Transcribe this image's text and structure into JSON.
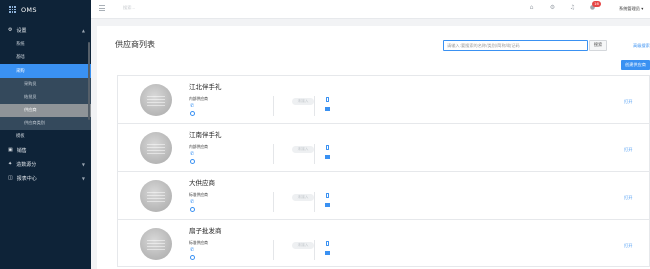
{
  "app": {
    "name": "OMS"
  },
  "sidebar": {
    "groups": [
      {
        "label": "设置",
        "icon": "gear-icon"
      },
      {
        "label": "销售",
        "icon": "shop-icon"
      },
      {
        "label": "造数源分",
        "icon": "star-icon"
      },
      {
        "label": "报表中心",
        "icon": "chart-icon"
      }
    ],
    "items": [
      "系统",
      "基础",
      "采购",
      "采购员",
      "结批员",
      "供应商",
      "供应商类别",
      "模板"
    ]
  },
  "topbar": {
    "search_placeholder": "搜索...",
    "notification_count": "16",
    "user_label": "系统管理员 ▾"
  },
  "page": {
    "title": "供应商列表",
    "search_placeholder": "请输入:要搜索的名称/类别/简称/助记码",
    "search_button": "搜索",
    "advanced_search": "高级搜索",
    "create_button": "创建供应商"
  },
  "suppliers": [
    {
      "name": "江北伴手礼",
      "type": "内部供应商",
      "status": "未接入",
      "action": "打开"
    },
    {
      "name": "江南伴手礼",
      "type": "内部供应商",
      "status": "未接入",
      "action": "打开"
    },
    {
      "name": "大供应商",
      "type": "标准供应商",
      "status": "未接入",
      "action": "打开"
    },
    {
      "name": "扇子批发商",
      "type": "标准供应商",
      "status": "未接入",
      "action": "打开"
    }
  ],
  "colors": {
    "sidebar_bg": "#0e2338",
    "accent": "#3a91f2",
    "badge": "#e64545"
  }
}
